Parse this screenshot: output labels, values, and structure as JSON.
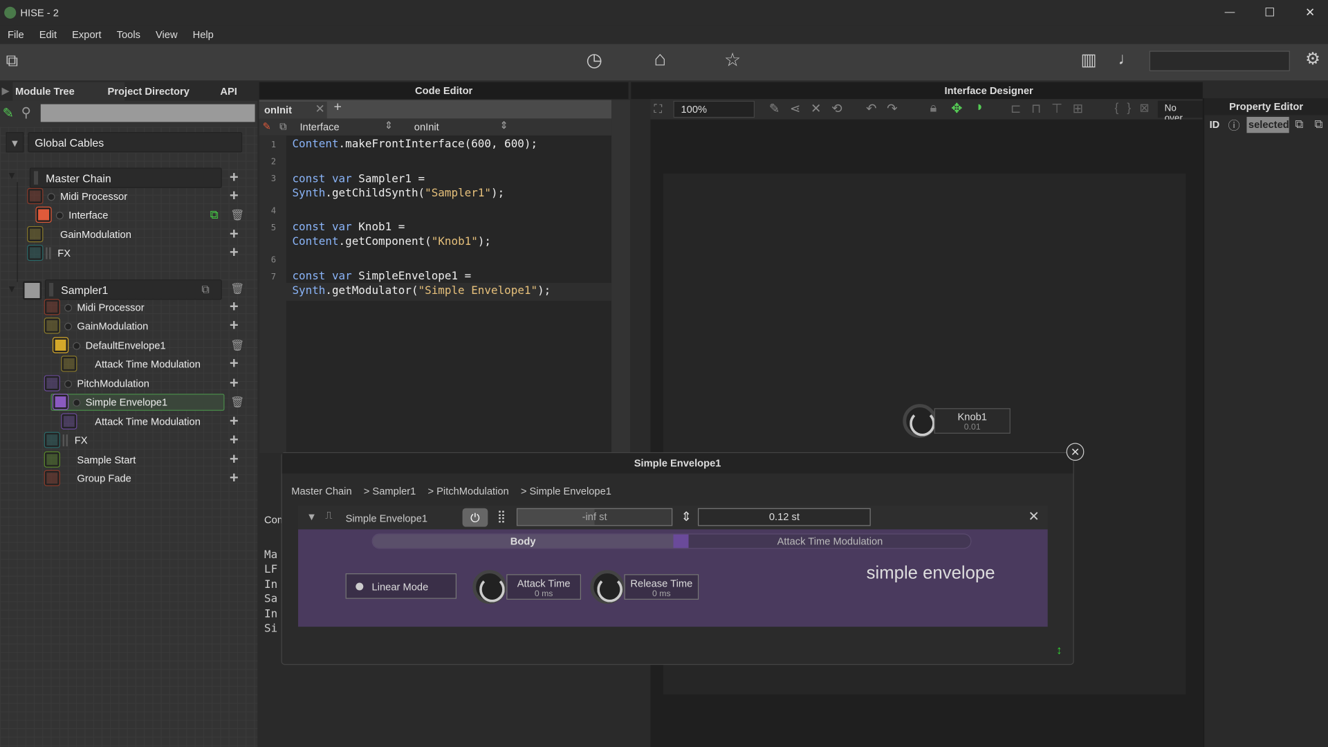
{
  "window": {
    "title": "HISE - 2",
    "min": "—",
    "max": "☐",
    "close": "✕"
  },
  "menu": [
    "File",
    "Edit",
    "Export",
    "Tools",
    "View",
    "Help"
  ],
  "left": {
    "tabs": [
      "Module Tree",
      "Project Directory",
      "API"
    ],
    "search_value": "",
    "global_cables": "Global Cables",
    "items": [
      {
        "label": "Master Chain",
        "color": "",
        "type": "chain"
      },
      {
        "label": "Midi Processor",
        "color": "#8a3a2a"
      },
      {
        "label": "Interface",
        "color": "#e05a3a"
      },
      {
        "label": "GainModulation",
        "color": "#8a7a2a"
      },
      {
        "label": "FX",
        "color": "#2a6a6a"
      },
      {
        "label": "Sampler1",
        "color": "#999999",
        "type": "chain"
      },
      {
        "label": "Midi Processor",
        "color": "#8a3a2a"
      },
      {
        "label": "GainModulation",
        "color": "#8a7a2a"
      },
      {
        "label": "DefaultEnvelope1",
        "color": "#d4a82a"
      },
      {
        "label": "Attack Time Modulation",
        "color": "#8a7a2a"
      },
      {
        "label": "PitchModulation",
        "color": "#6a4a9a"
      },
      {
        "label": "Simple Envelope1",
        "color": "#8a5ac0",
        "selected": true
      },
      {
        "label": "Attack Time Modulation",
        "color": "#6a4a9a"
      },
      {
        "label": "FX",
        "color": "#2a6a6a"
      },
      {
        "label": "Sample Start",
        "color": "#5a8a2a"
      },
      {
        "label": "Group Fade",
        "color": "#8a3a2a"
      }
    ]
  },
  "code_editor": {
    "title": "Code Editor",
    "tab": "onInit",
    "dropdown1": "Interface",
    "dropdown2": "onInit",
    "lines": [
      "1",
      "2",
      "3",
      "",
      "4",
      "5",
      "",
      "6",
      "7",
      ""
    ],
    "console_label": "Com",
    "console_lines": [
      "Ma",
      "LF",
      "In",
      "Sa",
      "In",
      "Si"
    ]
  },
  "code": {
    "l1a": "Content",
    "l1b": ".makeFrontInterface(600, 600);",
    "l3a": "const var",
    "l3b": " Sampler1 =",
    "l3c": "Synth",
    "l3d": ".getChildSynth(",
    "l3e": "\"Sampler1\"",
    "l3f": ");",
    "l5a": "const var",
    "l5b": " Knob1 =",
    "l5c": "Content",
    "l5d": ".getComponent(",
    "l5e": "\"Knob1\"",
    "l5f": ");",
    "l7a": "const var",
    "l7b": " SimpleEnvelope1 =",
    "l7c": "Synth",
    "l7d": ".getModulator(",
    "l7e": "\"Simple Envelope1\"",
    "l7f": ");"
  },
  "designer": {
    "title": "Interface Designer",
    "zoom": "100%",
    "no_over": "No over",
    "knob_label": "Knob1",
    "knob_value": "0.01"
  },
  "property_editor": {
    "title": "Property Editor",
    "id": "ID",
    "selected": "selected"
  },
  "popup": {
    "title": "Simple Envelope1",
    "breadcrumb": [
      "Master Chain",
      "> Sampler1",
      "> PitchModulation",
      "> Simple Envelope1"
    ],
    "module_name": "Simple Envelope1",
    "meter_value": "-inf st",
    "intensity_value": "0.12 st",
    "tabs": [
      "Body",
      "Attack Time Modulation"
    ],
    "linear_mode": "Linear Mode",
    "attack_label": "Attack Time",
    "attack_value": "0 ms",
    "release_label": "Release Time",
    "release_value": "0 ms",
    "heading": "simple envelope",
    "body_color": "#4a3a5e"
  }
}
